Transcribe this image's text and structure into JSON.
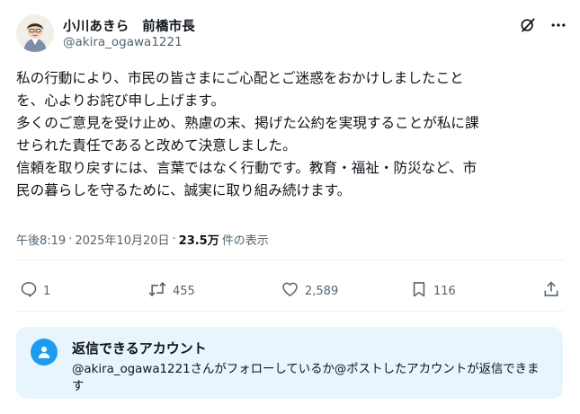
{
  "author": {
    "display_name": "小川あきら　前橋市長",
    "handle": "@akira_ogawa1221"
  },
  "tweet": {
    "lines": [
      "私の行動により、市民の皆さまにご心配とご迷惑をおかけしましたこと",
      "を、心よりお詫び申し上げます。",
      "多くのご意見を受け止め、熟慮の末、掲げた公約を実現することが私に課",
      "せられた責任であると改めて決意しました。",
      "信頼を取り戻すには、言葉ではなく行動です。教育・福祉・防災など、市",
      "民の暮らしを守るために、誠実に取り組み続けます。"
    ]
  },
  "meta": {
    "time": "午後8:19",
    "separator": "·",
    "date": "2025年10月20日",
    "views_count": "23.5万",
    "views_label": "件の表示"
  },
  "actions": {
    "replies": "1",
    "retweets": "455",
    "likes": "2,589",
    "bookmarks": "116"
  },
  "reply_restriction": {
    "title": "返信できるアカウント",
    "description": "@akira_ogawa1221さんがフォローしているか@ポストしたアカウントが返信できます"
  },
  "icons": {
    "header": [
      "grok-icon",
      "more-icon"
    ],
    "actions": [
      "reply-icon",
      "retweet-icon",
      "like-icon",
      "bookmark-icon",
      "share-icon"
    ],
    "reply_card": "at-user-icon"
  },
  "colors": {
    "text": "#0f1419",
    "secondary": "#536471",
    "accent": "#1d9bf0",
    "card_bg": "#e8f5fd"
  }
}
